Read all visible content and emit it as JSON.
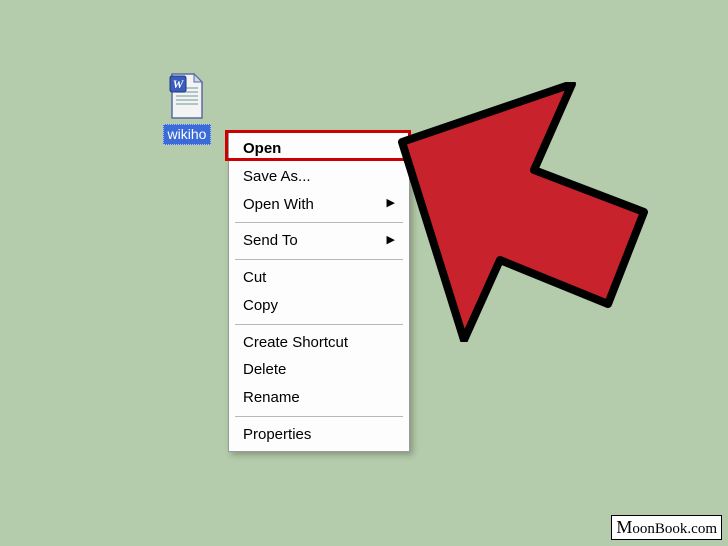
{
  "file": {
    "label": "wikiho",
    "icon_name": "word-doc-icon"
  },
  "context_menu": {
    "items": [
      {
        "label": "Open",
        "bold": true,
        "submenu": false
      },
      {
        "label": "Save As...",
        "bold": false,
        "submenu": false
      },
      {
        "label": "Open With",
        "bold": false,
        "submenu": true
      },
      {
        "separator": true
      },
      {
        "label": "Send To",
        "bold": false,
        "submenu": true
      },
      {
        "separator": true
      },
      {
        "label": "Cut",
        "bold": false,
        "submenu": false
      },
      {
        "label": "Copy",
        "bold": false,
        "submenu": false
      },
      {
        "separator": true
      },
      {
        "label": "Create Shortcut",
        "bold": false,
        "submenu": false
      },
      {
        "label": "Delete",
        "bold": false,
        "submenu": false
      },
      {
        "label": "Rename",
        "bold": false,
        "submenu": false
      },
      {
        "separator": true
      },
      {
        "label": "Properties",
        "bold": false,
        "submenu": false
      }
    ],
    "highlighted_index": 0
  },
  "cursor": {
    "color": "#c8232c",
    "stroke": "#000000"
  },
  "watermark": {
    "text_lead": "M",
    "text_rest": "oonBook.com"
  }
}
